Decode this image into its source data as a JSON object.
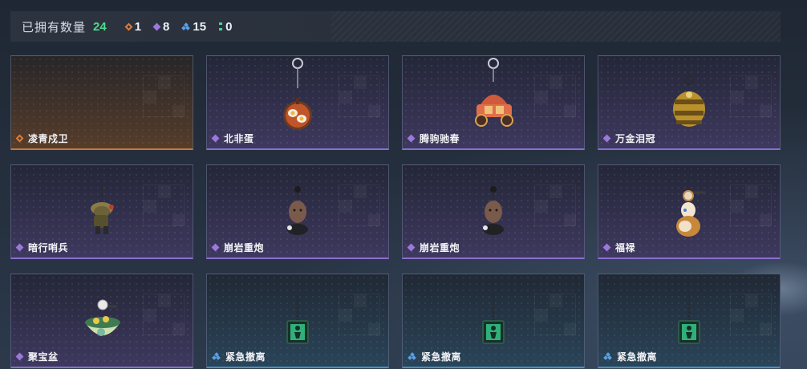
{
  "header": {
    "owned_label": "已拥有数量",
    "owned_count": "24",
    "stats": [
      {
        "icon": "orange-gem-icon",
        "value": "1"
      },
      {
        "icon": "purple-gem-icon",
        "value": "8"
      },
      {
        "icon": "blue-gem-icon",
        "value": "15"
      },
      {
        "icon": "green-gem-icon",
        "value": "0"
      }
    ]
  },
  "rarity_colors": {
    "orange": "#e07a3a",
    "purple": "#9b78d9",
    "blue": "#5aa0e6",
    "green": "#4fcf9a",
    "owned_count": "#4ddc8a"
  },
  "items": [
    {
      "name": "凌青戍卫",
      "rarity": "orange",
      "charm": "none"
    },
    {
      "name": "北非蛋",
      "rarity": "purple",
      "charm": "shakshuka-pan-charm"
    },
    {
      "name": "腾驹驰春",
      "rarity": "purple",
      "charm": "red-carriage-charm"
    },
    {
      "name": "万金泪冠",
      "rarity": "purple",
      "charm": "golden-crown-charm"
    },
    {
      "name": "暗行哨兵",
      "rarity": "purple",
      "charm": "camo-sentry-charm"
    },
    {
      "name": "崩岩重炮",
      "rarity": "purple",
      "charm": "rock-cannon-charm"
    },
    {
      "name": "崩岩重炮",
      "rarity": "purple",
      "charm": "rock-cannon-charm"
    },
    {
      "name": "福禄",
      "rarity": "purple",
      "charm": "gourd-charm"
    },
    {
      "name": "聚宝盆",
      "rarity": "purple",
      "charm": "treasure-bowl-charm"
    },
    {
      "name": "紧急撤离",
      "rarity": "blue",
      "charm": "exit-sign-charm"
    },
    {
      "name": "紧急撤离",
      "rarity": "blue",
      "charm": "exit-sign-charm"
    },
    {
      "name": "紧急撤离",
      "rarity": "blue",
      "charm": "exit-sign-charm"
    }
  ]
}
